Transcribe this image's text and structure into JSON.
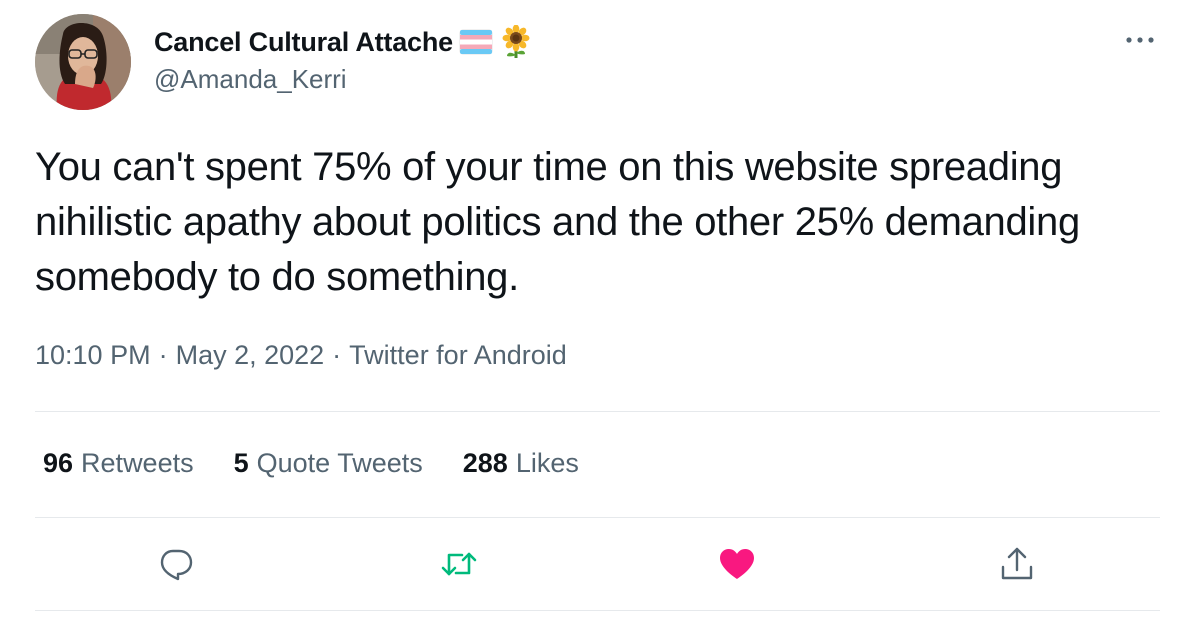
{
  "author": {
    "display_name": "Cancel Cultural Attache",
    "handle": "@Amanda_Kerri",
    "name_emojis": [
      "transgender-flag-icon",
      "sunflower-icon"
    ]
  },
  "tweet": {
    "text": "You can't spent 75% of your time on this website spreading nihilistic apathy about politics and the other 25% demanding somebody to do something.",
    "time": "10:10 PM",
    "date": "May 2, 2022",
    "source": "Twitter for Android",
    "separator": "·"
  },
  "stats": {
    "retweets": {
      "count": "96",
      "label": "Retweets"
    },
    "quote_tweets": {
      "count": "5",
      "label": "Quote Tweets"
    },
    "likes": {
      "count": "288",
      "label": "Likes"
    }
  },
  "actions": {
    "reply_icon": "reply-icon",
    "retweet_icon": "retweet-icon",
    "like_icon": "heart-icon",
    "share_icon": "share-icon",
    "more_icon": "more-icon"
  },
  "colors": {
    "text_primary": "#0f1419",
    "text_secondary": "#536471",
    "retweet_green": "#00ba7c",
    "like_pink": "#f91880",
    "divider": "#e6e9ec"
  }
}
